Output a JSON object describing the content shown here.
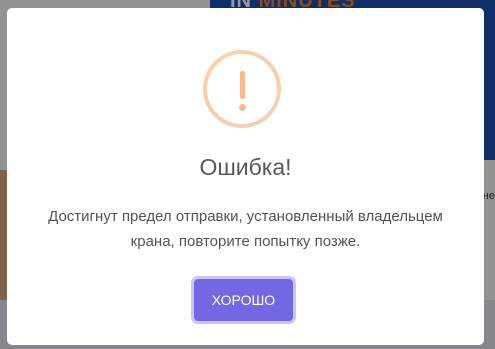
{
  "background": {
    "banner_word1": "IN",
    "banner_word2": "MINUTES",
    "right_edge_text": "не"
  },
  "dialog": {
    "icon": "exclamation-warning-icon",
    "title": "Ошибка!",
    "message": "Достигнут предел отправки, установленный владельцем крана, повторите попытку позже.",
    "ok_button_label": "ХОРОШО"
  },
  "colors": {
    "icon_ring": "#facea8",
    "icon_mark": "#f8bb86",
    "button": "#7367e4",
    "banner_blue": "#1a4fb0",
    "banner_orange": "#f07a2b"
  }
}
